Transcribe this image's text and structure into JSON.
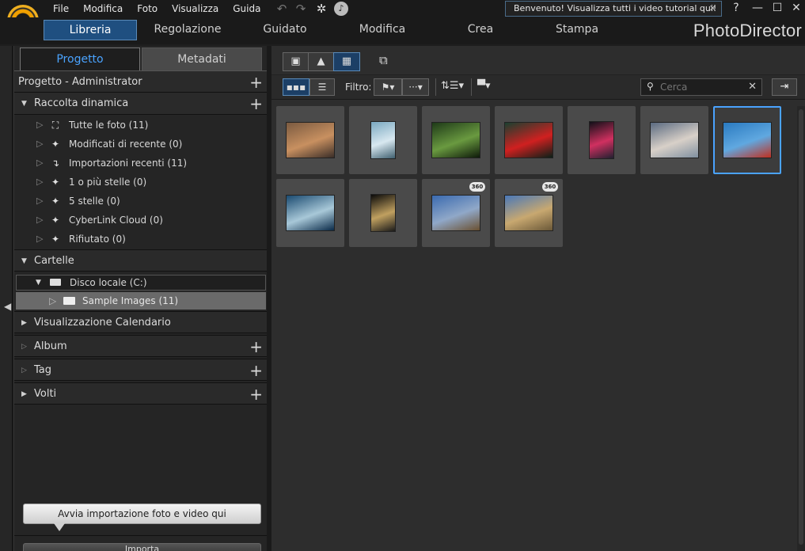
{
  "app": {
    "brand": "PhotoDirector"
  },
  "menu": [
    "File",
    "Modifica",
    "Foto",
    "Visualizza",
    "Guida"
  ],
  "welcome_banner": "Benvenuto! Visualizza tutti i video tutorial qui!",
  "help_label": "?",
  "nav_tabs": [
    "Libreria",
    "Regolazione",
    "Guidato",
    "Modifica",
    "Crea",
    "Stampa"
  ],
  "panel_tabs": {
    "project": "Progetto",
    "metadata": "Metadati"
  },
  "project_header": "Progetto - Administrator",
  "smart_collection": {
    "title": "Raccolta dinamica",
    "items": [
      {
        "label": "Tutte le foto (11)",
        "icon": "hierarchy-icon"
      },
      {
        "label": "Modificati di recente (0)",
        "icon": "magic-wand-icon"
      },
      {
        "label": "Importazioni recenti (11)",
        "icon": "import-arrow-icon"
      },
      {
        "label": "1 o più stelle (0)",
        "icon": "magic-wand-icon"
      },
      {
        "label": "5 stelle (0)",
        "icon": "magic-wand-icon"
      },
      {
        "label": "CyberLink Cloud (0)",
        "icon": "magic-wand-icon"
      },
      {
        "label": "Rifiutato (0)",
        "icon": "magic-wand-icon"
      }
    ]
  },
  "folders": {
    "title": "Cartelle",
    "drive": "Disco locale (C:)",
    "folder": "Sample Images (11)"
  },
  "calendar_view": "Visualizzazione Calendario",
  "album": "Album",
  "tag": "Tag",
  "faces": "Volti",
  "import_tip": "Avvia importazione foto e video qui",
  "import_button": "Importa",
  "toolbar": {
    "filter_label": "Filtro:",
    "search_placeholder": "Cerca"
  },
  "thumbnails": [
    {
      "colors": [
        "#7a5a40",
        "#c89060",
        "#3a2e28"
      ],
      "orientation": "landscape",
      "badge": ""
    },
    {
      "colors": [
        "#7aa8c0",
        "#d8e8f0",
        "#406070"
      ],
      "orientation": "portrait",
      "badge": ""
    },
    {
      "colors": [
        "#1e3a18",
        "#6a9a40",
        "#0e1a0a"
      ],
      "orientation": "landscape",
      "badge": ""
    },
    {
      "colors": [
        "#1a4030",
        "#d02020",
        "#0a2018"
      ],
      "orientation": "landscape",
      "badge": ""
    },
    {
      "colors": [
        "#101018",
        "#d03060",
        "#202030"
      ],
      "orientation": "portrait",
      "badge": ""
    },
    {
      "colors": [
        "#5a6a80",
        "#d8d0c8",
        "#8090a0"
      ],
      "orientation": "landscape",
      "badge": ""
    },
    {
      "colors": [
        "#2a7ac0",
        "#60a8e0",
        "#c03020"
      ],
      "orientation": "landscape",
      "badge": "",
      "selected": true
    },
    {
      "colors": [
        "#1a4a70",
        "#a8c8d8",
        "#0a2a48"
      ],
      "orientation": "landscape",
      "badge": ""
    },
    {
      "colors": [
        "#0a0a0a",
        "#c0a060",
        "#1a1a1a"
      ],
      "orientation": "portrait",
      "badge": ""
    },
    {
      "colors": [
        "#3a6ab0",
        "#90a8c8",
        "#6a5030"
      ],
      "orientation": "landscape",
      "badge": "360"
    },
    {
      "colors": [
        "#4a78b8",
        "#c8a870",
        "#6a5838"
      ],
      "orientation": "landscape",
      "badge": "360"
    }
  ]
}
